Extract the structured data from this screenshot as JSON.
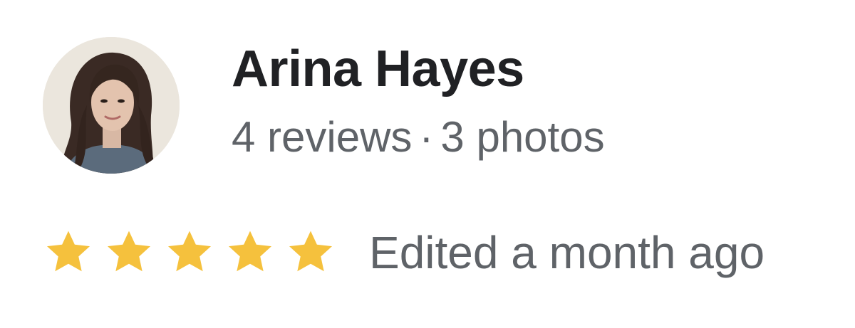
{
  "author": {
    "name": "Arina Hayes",
    "reviews": "4 reviews",
    "separator": "·",
    "photos": "3 photos"
  },
  "rating": {
    "stars": 5,
    "max": 5,
    "star_color": "#F5C13D",
    "icon": "star-icon"
  },
  "timestamp": "Edited a month ago",
  "colors": {
    "name": "#202124",
    "secondary": "#5f6368"
  }
}
